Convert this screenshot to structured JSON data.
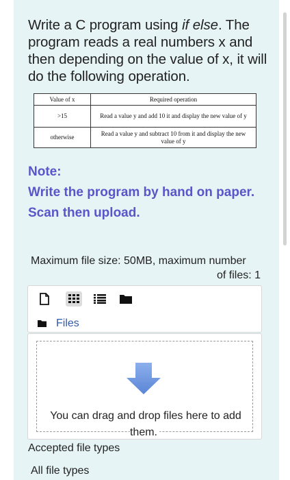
{
  "question": {
    "part1": "Write a C program using ",
    "emph": "if else",
    "part2": ". The program reads a real numbers x and then depending on the value of x, it will do the following operation."
  },
  "table": {
    "headers": [
      "Value of x",
      "Required operation"
    ],
    "rows": [
      [
        ">15",
        "Read a value y and add 10 it and display the new value of y"
      ],
      [
        "otherwise",
        "Read a value y and subtract 10 from it and display the new value of y"
      ]
    ]
  },
  "note": {
    "title": "Note:",
    "text": "Write the program by hand on paper. Scan then upload."
  },
  "upload": {
    "limits_line1": "Maximum file size: 50MB, maximum number",
    "limits_line2": "of files: 1",
    "files_link": "Files",
    "drop_text": "You can drag and drop files here to add them.",
    "accepted_label": "Accepted file types",
    "accepted_value": "All file types",
    "toolbar_icons": [
      "add-file-icon",
      "grid-view-icon",
      "list-view-icon",
      "folder-view-icon"
    ]
  },
  "colors": {
    "card_bg": "#e7f4f6",
    "note": "#5a55c8",
    "link": "#2f5aa8",
    "arrow": "#6f97df"
  }
}
